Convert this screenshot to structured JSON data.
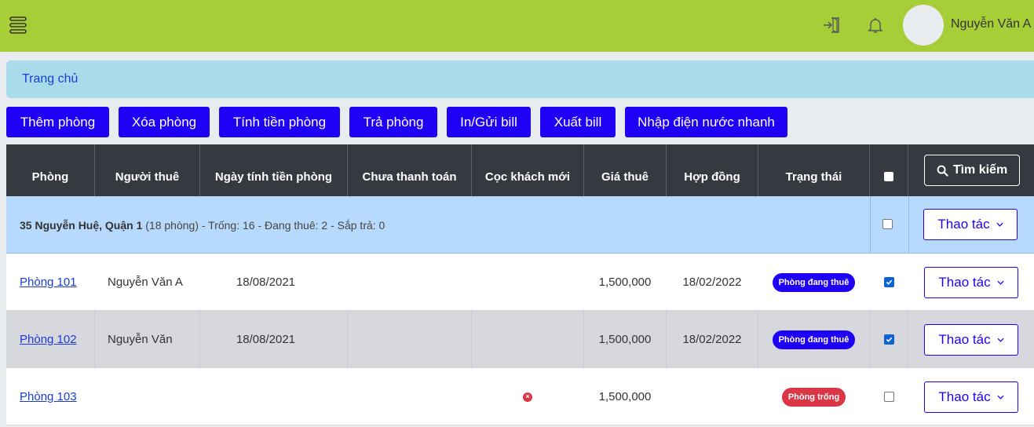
{
  "header": {
    "user_name": "Nguyễn Văn A",
    "icons": [
      "menu-icon",
      "logout-icon",
      "bell-icon",
      "avatar"
    ]
  },
  "breadcrumb": {
    "home": "Trang chủ"
  },
  "toolbar": {
    "add_room": "Thêm phòng",
    "delete_room": "Xóa phòng",
    "calc_rent": "Tính tiền phòng",
    "return_room": "Trả phòng",
    "print_bill": "In/Gửi bill",
    "export_bill": "Xuất bill",
    "quick_input": "Nhập điện nước nhanh"
  },
  "table": {
    "columns": [
      "Phòng",
      "Người thuê",
      "Ngày tính tiền phòng",
      "Chưa thanh toán",
      "Cọc khách mới",
      "Giá thuê",
      "Hợp đồng",
      "Trạng thái"
    ],
    "search_label": "Tìm kiếm",
    "action_label": "Thao tác",
    "group": {
      "name": "35 Nguyễn Huệ, Quận 1",
      "summary": " (18 phòng) - Trống: 16 - Đang thuê: 2 - Sắp trả: 0"
    },
    "rows": [
      {
        "room": "Phòng 101",
        "tenant": "Nguyễn Văn A",
        "bill_date": "18/08/2021",
        "unpaid": "",
        "deposit": "",
        "price": "1,500,000",
        "contract": "18/02/2022",
        "status": "Phòng đang thuê",
        "status_color": "#1f00f5",
        "checked": true
      },
      {
        "room": "Phòng 102",
        "tenant": "Nguyễn Văn",
        "bill_date": "18/08/2021",
        "unpaid": "",
        "deposit": "",
        "price": "1,500,000",
        "contract": "18/02/2022",
        "status": "Phòng đang thuê",
        "status_color": "#1f00f5",
        "checked": true
      },
      {
        "room": "Phòng 103",
        "tenant": "",
        "bill_date": "",
        "unpaid": "",
        "deposit": "x-circle-icon",
        "price": "1,500,000",
        "contract": "",
        "status": "Phòng trống",
        "status_color": "#dc3545",
        "checked": false
      }
    ]
  },
  "colors": {
    "topbar": "#a6cf37",
    "primary": "#1f00f5",
    "breadcrumb_bg": "#a9dcea",
    "header_bg": "#343a40",
    "group_bg": "#b7dafc",
    "danger": "#dc3545"
  }
}
